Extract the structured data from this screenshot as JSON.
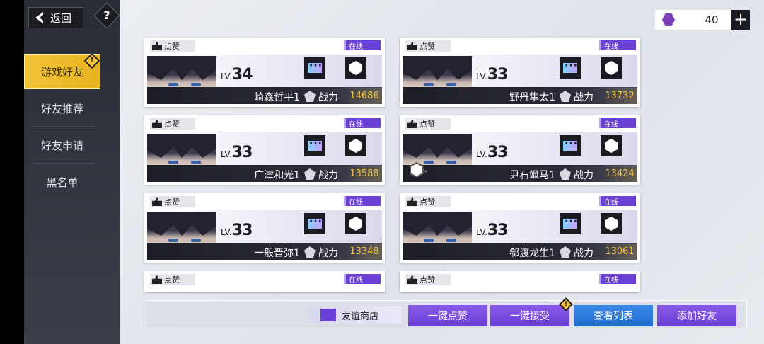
{
  "header": {
    "back_label": "返回",
    "help_label": "?",
    "currency_value": "40",
    "currency_plus": "+"
  },
  "sidebar": {
    "items": [
      {
        "label": "游戏好友"
      },
      {
        "label": "好友推荐"
      },
      {
        "label": "好友申请"
      },
      {
        "label": "黑名单"
      }
    ],
    "badge": "!"
  },
  "card_labels": {
    "like": "点赞",
    "online": "在线",
    "level_prefix": "LV.",
    "power": "战力"
  },
  "friends": [
    {
      "name": "崎森哲平1",
      "level": "34",
      "power": "14686"
    },
    {
      "name": "野丹隼太1",
      "level": "33",
      "power": "13732"
    },
    {
      "name": "广津和光1",
      "level": "33",
      "power": "13588"
    },
    {
      "name": "尹石飒马1",
      "level": "33",
      "power": "13424"
    },
    {
      "name": "一般晋弥1",
      "level": "33",
      "power": "13348"
    },
    {
      "name": "郗渡龙生1",
      "level": "33",
      "power": "13061"
    }
  ],
  "bottom": {
    "shop_label": "友谊商店",
    "like_all": "一键点赞",
    "accept_all": "一键接受",
    "view_list": "查看列表",
    "add_friend": "添加好友",
    "badge": "!"
  },
  "colors": {
    "accent_purple": "#6a3fd6",
    "accent_blue": "#1f6bd0",
    "active_tab": "#f2c23a",
    "power_gold": "#f5c542"
  }
}
